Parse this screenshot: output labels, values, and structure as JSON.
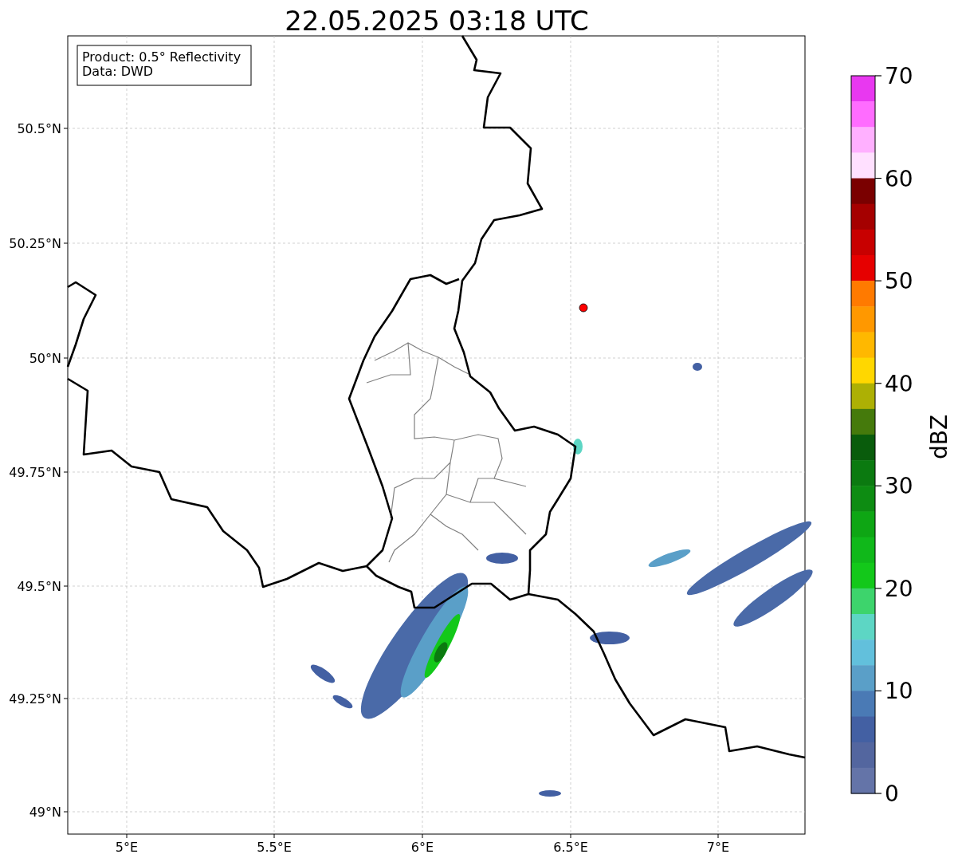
{
  "title": "22.05.2025 03:18 UTC",
  "info_box": {
    "lines": [
      "Product: 0.5° Reflectivity",
      "Data: DWD"
    ]
  },
  "y_ticks": [
    "50.5°N",
    "50.25°N",
    "50°N",
    "49.75°N",
    "49.5°N",
    "49.25°N",
    "49°N"
  ],
  "x_ticks": [
    "5°E",
    "5.5°E",
    "6°E",
    "6.5°E",
    "7°E"
  ],
  "colorbar": {
    "label": "dBZ",
    "ticks": [
      "70",
      "60",
      "50",
      "40",
      "30",
      "20",
      "10",
      "0"
    ],
    "bins": [
      {
        "color": "#e838f0"
      },
      {
        "color": "#ff6cff"
      },
      {
        "color": "#ffb0ff"
      },
      {
        "color": "#ffe0ff"
      },
      {
        "color": "#7a0000"
      },
      {
        "color": "#a50000"
      },
      {
        "color": "#c80000"
      },
      {
        "color": "#e60000"
      },
      {
        "color": "#ff7a00"
      },
      {
        "color": "#ff9800"
      },
      {
        "color": "#ffb800"
      },
      {
        "color": "#ffd700"
      },
      {
        "color": "#adb004"
      },
      {
        "color": "#457a0c"
      },
      {
        "color": "#095c0c"
      },
      {
        "color": "#0b7a10"
      },
      {
        "color": "#0d8c12"
      },
      {
        "color": "#0ea614"
      },
      {
        "color": "#10b81a"
      },
      {
        "color": "#13c81a"
      },
      {
        "color": "#3dd46c"
      },
      {
        "color": "#5dd6c4"
      },
      {
        "color": "#62c0dc"
      },
      {
        "color": "#5a9fc8"
      },
      {
        "color": "#4a7ab5"
      },
      {
        "color": "#4360a3"
      },
      {
        "color": "#53669f"
      },
      {
        "color": "#6474a8"
      }
    ]
  }
}
